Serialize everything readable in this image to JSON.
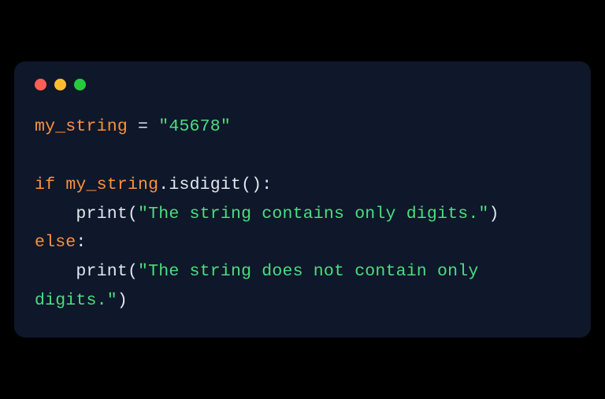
{
  "code": {
    "lines": [
      {
        "tokens": [
          {
            "cls": "tok-ident",
            "text": "my_string"
          },
          {
            "cls": "tok-op",
            "text": " = "
          },
          {
            "cls": "tok-str",
            "text": "\"45678\""
          }
        ]
      },
      {
        "blank": true
      },
      {
        "tokens": [
          {
            "cls": "tok-kw",
            "text": "if"
          },
          {
            "cls": "tok-op",
            "text": " "
          },
          {
            "cls": "tok-ident",
            "text": "my_string"
          },
          {
            "cls": "tok-punct",
            "text": "."
          },
          {
            "cls": "tok-func",
            "text": "isdigit"
          },
          {
            "cls": "tok-punct",
            "text": "():"
          }
        ]
      },
      {
        "tokens": [
          {
            "cls": "tok-op",
            "text": "    "
          },
          {
            "cls": "tok-func",
            "text": "print"
          },
          {
            "cls": "tok-punct",
            "text": "("
          },
          {
            "cls": "tok-str",
            "text": "\"The string contains only digits.\""
          },
          {
            "cls": "tok-punct",
            "text": ")"
          }
        ]
      },
      {
        "tokens": [
          {
            "cls": "tok-kw",
            "text": "else"
          },
          {
            "cls": "tok-punct",
            "text": ":"
          }
        ]
      },
      {
        "tokens": [
          {
            "cls": "tok-op",
            "text": "    "
          },
          {
            "cls": "tok-func",
            "text": "print"
          },
          {
            "cls": "tok-punct",
            "text": "("
          },
          {
            "cls": "tok-str",
            "text": "\"The string does not contain only digits.\""
          },
          {
            "cls": "tok-punct",
            "text": ")"
          }
        ]
      }
    ]
  },
  "colors": {
    "window_bg": "#0f172a",
    "page_bg": "#000000",
    "red": "#ff5f56",
    "yellow": "#ffbd2e",
    "green": "#27c93f",
    "identifier": "#fb923c",
    "keyword": "#fb923c",
    "string": "#4ade80",
    "default": "#e2e8f0"
  }
}
